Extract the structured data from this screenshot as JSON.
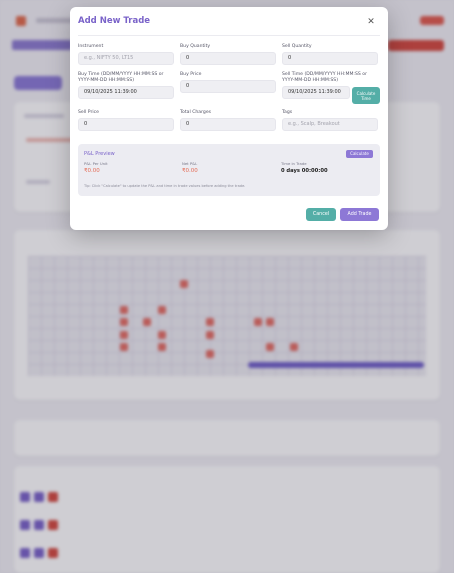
{
  "modal": {
    "title": "Add New Trade",
    "close_glyph": "✕",
    "fields": {
      "instrument": {
        "label": "Instrument",
        "placeholder": "e.g., NIFTY 50, LT15"
      },
      "buy_quantity": {
        "label": "Buy Quantity",
        "value": "0"
      },
      "sell_quantity": {
        "label": "Sell Quantity",
        "value": "0"
      },
      "buy_time": {
        "label": "Buy Time (DD/MM/YYYY HH:MM:SS or YYYY-MM-DD HH:MM:SS)",
        "value": "09/10/2025 11:39:00"
      },
      "buy_price": {
        "label": "Buy Price",
        "value": "0"
      },
      "sell_time": {
        "label": "Sell Time (DD/MM/YYYY HH:MM:SS or YYYY-MM-DD HH:MM:SS)",
        "value": "09/10/2025 11:39:00"
      },
      "sell_price": {
        "label": "Sell Price",
        "value": "0"
      },
      "total_charges": {
        "label": "Total Charges",
        "value": "0"
      },
      "tags": {
        "label": "Tags",
        "placeholder": "e.g., Scalp, Breakout"
      }
    },
    "calculate_time_label": "Calculate Time",
    "pnl_preview": {
      "title": "P&L Preview",
      "calculate_label": "Calculate",
      "pnl_per_unit_label": "P&L Per Unit",
      "pnl_per_unit_value": "₹0.00",
      "net_pnl_label": "Net P&L",
      "net_pnl_value": "₹0.00",
      "time_in_trade_label": "Time in Trade",
      "time_in_trade_value": "0 days 00:00:00",
      "tip": "Tip: Click \"Calculate\" to update the P&L and time in trade values before adding the trade."
    },
    "cancel_label": "Cancel",
    "add_trade_label": "Add Trade"
  },
  "colors": {
    "accent_purple": "#8d78d6",
    "title_purple": "#7a63c9",
    "teal": "#54aea7",
    "loss_red": "#e46b55"
  }
}
